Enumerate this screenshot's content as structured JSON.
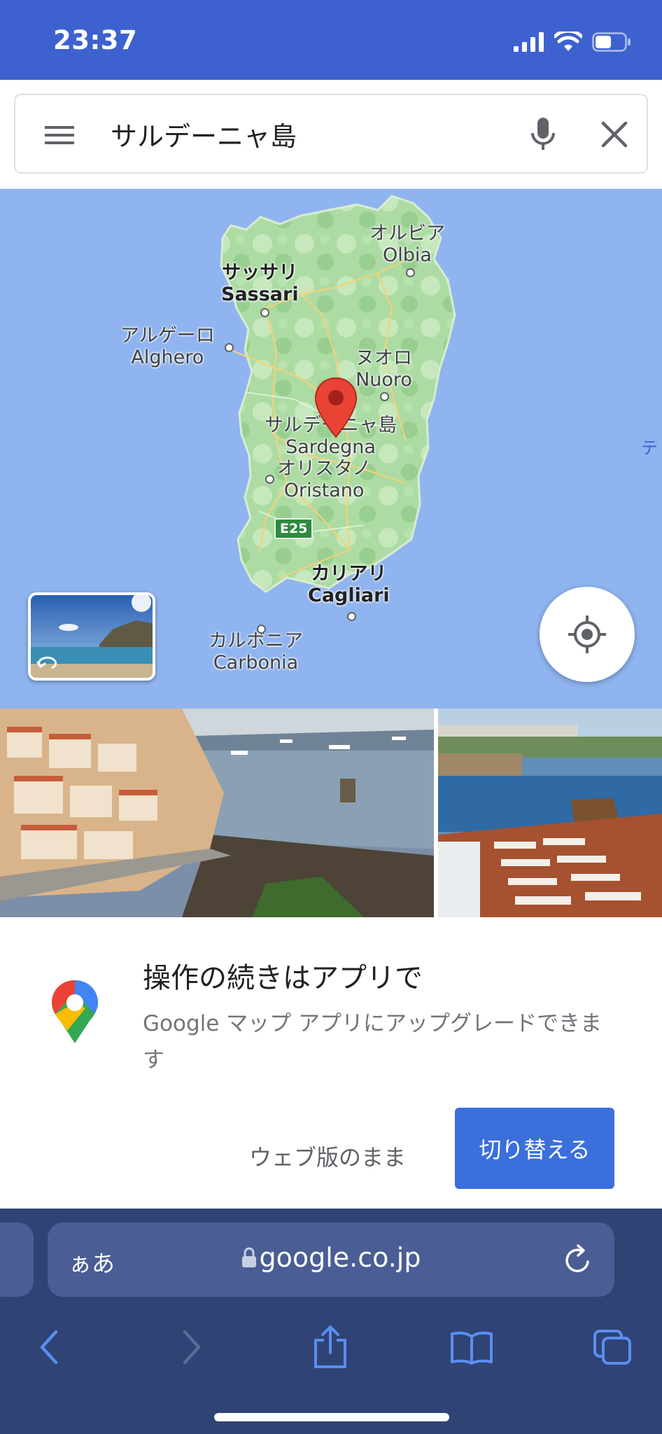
{
  "status_bar": {
    "time": "23:37",
    "icons": [
      "cellular-signal-icon",
      "wifi-icon",
      "battery-icon"
    ]
  },
  "search": {
    "query": "サルデーニャ島",
    "icons": [
      "hamburger-menu-icon",
      "microphone-icon",
      "close-icon"
    ]
  },
  "map": {
    "labels": {
      "olbia_jp": "オルビア",
      "olbia_en": "Olbia",
      "sassari_jp": "サッサリ",
      "sassari_en": "Sassari",
      "alghero_jp": "アルゲーロ",
      "alghero_en": "Alghero",
      "nuoro_jp": "ヌオロ",
      "nuoro_en": "Nuoro",
      "sardegna_jp": "サルデーニャ島",
      "sardegna_en": "Sardegna",
      "oristano_jp": "オリスタノ",
      "oristano_en": "Oristano",
      "road": "E25",
      "cagliari_jp": "カリアリ",
      "cagliari_en": "Cagliari",
      "carbonia_jp": "カルボニア",
      "carbonia_en": "Carbonia",
      "edge": "テ"
    },
    "water_color": "#8fb4ef",
    "land_color": "#a8d8a0",
    "pin_color": "#e94335"
  },
  "prompt": {
    "title": "操作の続きはアプリで",
    "body": "Google マップ アプリにアップグレードできます",
    "stay_label": "ウェブ版のまま",
    "switch_label": "切り替える"
  },
  "browser": {
    "text_size": "ぁあ",
    "domain": "google.co.jp",
    "toolbar_icons": [
      "back-icon",
      "forward-icon",
      "share-icon",
      "bookmarks-icon",
      "tabs-icon"
    ]
  }
}
